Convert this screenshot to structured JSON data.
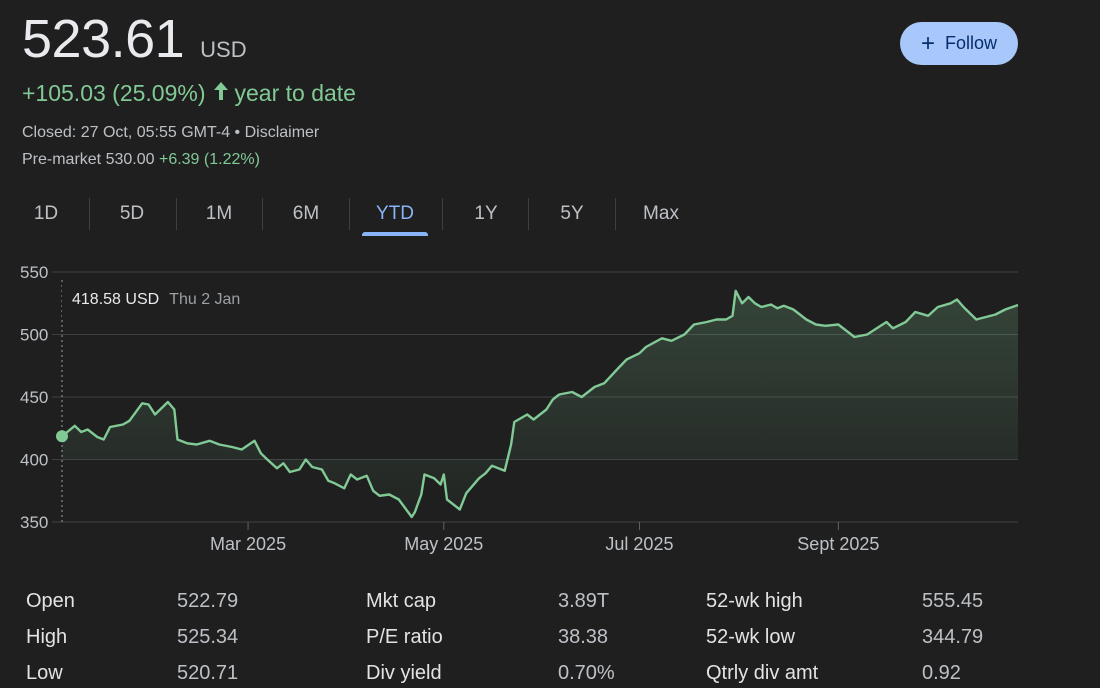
{
  "quote": {
    "price": "523.61",
    "currency": "USD",
    "change": "+105.03 (25.09%)",
    "period": "year to date",
    "closed": "Closed: 27 Oct, 05:55 GMT-4 • Disclaimer",
    "premarket_label": "Pre-market 530.00",
    "premarket_change": "+6.39 (1.22%)"
  },
  "follow_label": "Follow",
  "tabs": [
    "1D",
    "5D",
    "1M",
    "6M",
    "YTD",
    "1Y",
    "5Y",
    "Max"
  ],
  "active_tab": "YTD",
  "tooltip": {
    "value": "418.58 USD",
    "date": "Thu 2 Jan"
  },
  "colors": {
    "line": "#81c995",
    "accent": "#8ab4f8",
    "button": "#a8c7fa"
  },
  "chart_data": {
    "type": "area",
    "ylim": [
      350,
      550
    ],
    "yticks": [
      350,
      400,
      450,
      500,
      550
    ],
    "xlim": [
      "2025-01-02",
      "2025-10-27"
    ],
    "xticks": [
      {
        "date": "2025-03-01",
        "label": "Mar 2025"
      },
      {
        "date": "2025-05-01",
        "label": "May 2025"
      },
      {
        "date": "2025-07-01",
        "label": "Jul 2025"
      },
      {
        "date": "2025-09-01",
        "label": "Sept 2025"
      }
    ],
    "grid": true,
    "points": [
      [
        "2025-01-02",
        418.58
      ],
      [
        "2025-01-06",
        427
      ],
      [
        "2025-01-08",
        422
      ],
      [
        "2025-01-10",
        424
      ],
      [
        "2025-01-13",
        418
      ],
      [
        "2025-01-15",
        416
      ],
      [
        "2025-01-17",
        426
      ],
      [
        "2025-01-21",
        428
      ],
      [
        "2025-01-23",
        431
      ],
      [
        "2025-01-27",
        445
      ],
      [
        "2025-01-29",
        444
      ],
      [
        "2025-01-31",
        436
      ],
      [
        "2025-02-04",
        446
      ],
      [
        "2025-02-06",
        440
      ],
      [
        "2025-02-07",
        416
      ],
      [
        "2025-02-10",
        413
      ],
      [
        "2025-02-13",
        412
      ],
      [
        "2025-02-17",
        415
      ],
      [
        "2025-02-20",
        412
      ],
      [
        "2025-02-24",
        410
      ],
      [
        "2025-02-27",
        408
      ],
      [
        "2025-03-03",
        415
      ],
      [
        "2025-03-05",
        405
      ],
      [
        "2025-03-07",
        400
      ],
      [
        "2025-03-10",
        393
      ],
      [
        "2025-03-12",
        397
      ],
      [
        "2025-03-14",
        390
      ],
      [
        "2025-03-17",
        392
      ],
      [
        "2025-03-19",
        400
      ],
      [
        "2025-03-21",
        394
      ],
      [
        "2025-03-24",
        392
      ],
      [
        "2025-03-26",
        383
      ],
      [
        "2025-03-28",
        381
      ],
      [
        "2025-03-31",
        377
      ],
      [
        "2025-04-02",
        388
      ],
      [
        "2025-04-04",
        384
      ],
      [
        "2025-04-07",
        387
      ],
      [
        "2025-04-09",
        375
      ],
      [
        "2025-04-11",
        371
      ],
      [
        "2025-04-14",
        372
      ],
      [
        "2025-04-17",
        368
      ],
      [
        "2025-04-21",
        354
      ],
      [
        "2025-04-22",
        358
      ],
      [
        "2025-04-24",
        372
      ],
      [
        "2025-04-25",
        388
      ],
      [
        "2025-04-28",
        385
      ],
      [
        "2025-04-30",
        380
      ],
      [
        "2025-05-01",
        388
      ],
      [
        "2025-05-02",
        368
      ],
      [
        "2025-05-06",
        360
      ],
      [
        "2025-05-08",
        373
      ],
      [
        "2025-05-12",
        385
      ],
      [
        "2025-05-14",
        389
      ],
      [
        "2025-05-16",
        395
      ],
      [
        "2025-05-20",
        391
      ],
      [
        "2025-05-22",
        412
      ],
      [
        "2025-05-23",
        430
      ],
      [
        "2025-05-27",
        436
      ],
      [
        "2025-05-29",
        432
      ],
      [
        "2025-06-02",
        440
      ],
      [
        "2025-06-04",
        448
      ],
      [
        "2025-06-06",
        452
      ],
      [
        "2025-06-10",
        454
      ],
      [
        "2025-06-13",
        450
      ],
      [
        "2025-06-17",
        458
      ],
      [
        "2025-06-20",
        461
      ],
      [
        "2025-06-24",
        472
      ],
      [
        "2025-06-27",
        480
      ],
      [
        "2025-07-01",
        485
      ],
      [
        "2025-07-03",
        490
      ],
      [
        "2025-07-08",
        497
      ],
      [
        "2025-07-11",
        495
      ],
      [
        "2025-07-15",
        500
      ],
      [
        "2025-07-18",
        508
      ],
      [
        "2025-07-22",
        510
      ],
      [
        "2025-07-25",
        512
      ],
      [
        "2025-07-28",
        512
      ],
      [
        "2025-07-30",
        515
      ],
      [
        "2025-07-31",
        535
      ],
      [
        "2025-08-02",
        525
      ],
      [
        "2025-08-04",
        530
      ],
      [
        "2025-08-06",
        525
      ],
      [
        "2025-08-08",
        522
      ],
      [
        "2025-08-11",
        524
      ],
      [
        "2025-08-13",
        521
      ],
      [
        "2025-08-15",
        523
      ],
      [
        "2025-08-18",
        520
      ],
      [
        "2025-08-20",
        516
      ],
      [
        "2025-08-22",
        512
      ],
      [
        "2025-08-25",
        508
      ],
      [
        "2025-08-28",
        507
      ],
      [
        "2025-09-01",
        508
      ],
      [
        "2025-09-04",
        502
      ],
      [
        "2025-09-06",
        498
      ],
      [
        "2025-09-10",
        500
      ],
      [
        "2025-09-13",
        505
      ],
      [
        "2025-09-16",
        510
      ],
      [
        "2025-09-18",
        505
      ],
      [
        "2025-09-22",
        510
      ],
      [
        "2025-09-25",
        518
      ],
      [
        "2025-09-29",
        515
      ],
      [
        "2025-10-02",
        522
      ],
      [
        "2025-10-06",
        525
      ],
      [
        "2025-10-08",
        528
      ],
      [
        "2025-10-10",
        522
      ],
      [
        "2025-10-14",
        512
      ],
      [
        "2025-10-17",
        514
      ],
      [
        "2025-10-20",
        516
      ],
      [
        "2025-10-23",
        520
      ],
      [
        "2025-10-27",
        523.61
      ]
    ]
  },
  "stats": [
    [
      {
        "label": "Open",
        "value": "522.79"
      },
      {
        "label": "Mkt cap",
        "value": "3.89T"
      },
      {
        "label": "52-wk high",
        "value": "555.45"
      }
    ],
    [
      {
        "label": "High",
        "value": "525.34"
      },
      {
        "label": "P/E ratio",
        "value": "38.38"
      },
      {
        "label": "52-wk low",
        "value": "344.79"
      }
    ],
    [
      {
        "label": "Low",
        "value": "520.71"
      },
      {
        "label": "Div yield",
        "value": "0.70%"
      },
      {
        "label": "Qtrly div amt",
        "value": "0.92"
      }
    ]
  ]
}
